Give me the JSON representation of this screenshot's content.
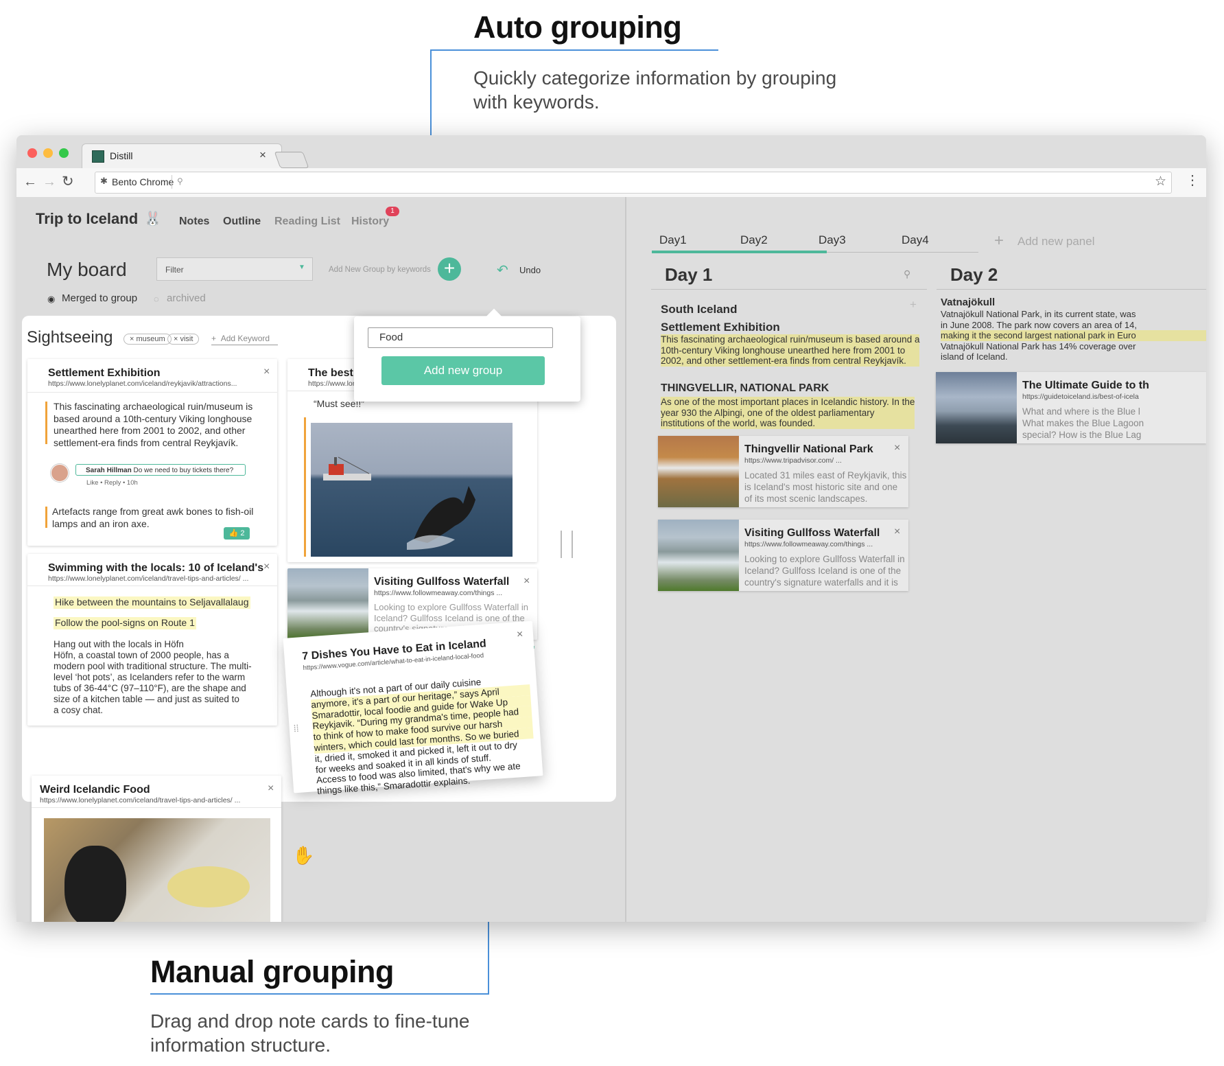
{
  "annotations": {
    "auto_title": "Auto grouping",
    "auto_desc_1": "Quickly categorize information by grouping",
    "auto_desc_2": "with keywords.",
    "manual_title": "Manual grouping",
    "manual_desc_1": "Drag and drop note cards to fine-tune",
    "manual_desc_2": "information structure."
  },
  "browser": {
    "tab_title": "Distill",
    "tab_close": "×",
    "address": "Bento Chrome"
  },
  "app": {
    "title": "Trip to Iceland",
    "nav": [
      "Notes",
      "Outline",
      "Reading List",
      "History"
    ],
    "history_badge": "1"
  },
  "board": {
    "title": "My board",
    "filter_placeholder": "Filter",
    "add_group_label": "Add New Group by keywords",
    "undo": "Undo",
    "merged": "Merged to group",
    "archived": "archived"
  },
  "popup": {
    "input_value": "Food",
    "button": "Add new group"
  },
  "group": {
    "name": "Sightseeing",
    "keywords": [
      "museum",
      "visit"
    ],
    "add_keyword": "Add Keyword"
  },
  "cards": {
    "settlement": {
      "title": "Settlement Exhibition",
      "url": "https://www.lonelyplanet.com/iceland/reykjavik/attractions...",
      "quote_1": [
        "This fascinating archaeological ruin/museum is",
        "based around a 10th-century Viking longhouse",
        "unearthed here from 2001 to 2002, and other",
        "settlement-era finds from central Reykjavík."
      ],
      "comment_author": "Sarah Hillman",
      "comment_text": "Do we need to buy tickets there?",
      "comment_meta": "Like • Reply • 10h",
      "quote_2": [
        "Artefacts range from great awk bones to fish-oil",
        "lamps and an iron axe."
      ],
      "likes": "2"
    },
    "whale": {
      "title": "The best places to watch wildlife in Iceland",
      "url": "https://www.lonelyplanet.com/iceland/travel-tips-and-articles/the...",
      "comment": "“Must see!!”"
    },
    "swimming": {
      "title": "Swimming with the locals: 10 of Iceland's",
      "url": "https://www.lonelyplanet.com/iceland/travel-tips-and-articles/ ...",
      "hl_1": "Hike between the mountains to Seljavallalaug",
      "hl_2": "Follow the pool-signs on Route 1",
      "body": [
        "Hang out with the locals in Höfn",
        "Höfn, a coastal town of 2000 people, has a",
        "modern pool with traditional structure. The multi-",
        "level ‘hot pots’, as Icelanders refer to the warm",
        "tubs of 36-44°C (97–110°F), are the shape and",
        "size of a kitchen table — and just as suited to",
        "a cosy chat."
      ]
    },
    "gullfoss_left": {
      "title": "Visiting Gullfoss Waterfall",
      "url": "https://www.followmeaway.com/things ...",
      "desc": [
        "Looking to explore Gullfoss Waterfall in",
        "Iceland? Gullfoss Iceland is one of the",
        "country's signature waterfalls and it is"
      ]
    },
    "dishes": {
      "title": "7 Dishes You Have to Eat in Iceland",
      "url": "https://www.vogue.com/article/what-to-eat-in-iceland-local-food",
      "lines": [
        "Although it's not a part of our daily cuisine",
        "anymore, it's a part of our heritage,” says April",
        "Smaradottir, local foodie and guide for Wake Up",
        "Reykjavik. “During my grandma's time, people had",
        "to think of how to make food survive our harsh",
        "winters, which could last for months. So we buried",
        "it, dried it, smoked it and picked it, left it out to dry",
        "for weeks and soaked it in all kinds of stuff.",
        "Access to food was also limited, that's why we ate",
        "things like this,” Smaradottir explains."
      ]
    },
    "weird_food": {
      "title": "Weird Icelandic Food",
      "url": "https://www.lonelyplanet.com/iceland/travel-tips-and-articles/ ..."
    }
  },
  "panel": {
    "tabs": [
      "Day1",
      "Day2",
      "Day3",
      "Day4"
    ],
    "add_panel": "Add new panel",
    "day1": {
      "title": "Day 1",
      "section_1": "South Iceland",
      "sub_1": "Settlement Exhibition",
      "sub_1_text": [
        "This fascinating archaeological ruin/museum is based around a",
        "10th-century Viking longhouse unearthed here from 2001 to",
        "2002, and other settlement-era finds from central Reykjavík."
      ],
      "section_2": "THINGVELLIR, NATIONAL PARK",
      "section_2_text": [
        "As one of the most important places in Icelandic history. In the",
        "year 930 the Alþingi, one of the oldest parliamentary",
        "institutions of the world, was founded."
      ],
      "card_1": {
        "title": "Thingvellir National Park",
        "url": "https://www.tripadvisor.com/ ...",
        "desc": [
          "Located 31 miles east of Reykjavik, this",
          "is Iceland's most historic site and one",
          "of its most scenic landscapes."
        ]
      },
      "card_2": {
        "title": "Visiting Gullfoss Waterfall",
        "url": "https://www.followmeaway.com/things ...",
        "desc": [
          "Looking to explore Gullfoss Waterfall in",
          "Iceland? Gullfoss Iceland is one of the",
          "country's signature waterfalls and it is"
        ]
      }
    },
    "day2": {
      "title": "Day 2",
      "section": "Vatnajökull",
      "text": [
        "Vatnajökull National Park, in its current state, was",
        "in June 2008. The park now covers an area of 14,",
        "making it the second largest national park in Euro",
        "Vatnajökull National Park has 14% coverage over",
        "island of Iceland."
      ],
      "card": {
        "title": "The Ultimate Guide to th",
        "url": "https://guidetoiceland.is/best-of-icela",
        "desc": [
          "What and where is the Blue l",
          "What makes the Blue Lagoon",
          "special? How is the Blue Lag"
        ]
      }
    }
  },
  "colors": {
    "accent_green": "#4db89a",
    "button_green": "#5bc7a6",
    "highlight_yellow": "#fbf7c2",
    "quote_orange": "#f0a33a",
    "annotation_blue": "#4a90d9",
    "badge_red": "#e0435a"
  }
}
